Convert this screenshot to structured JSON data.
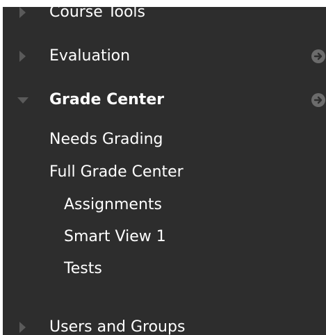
{
  "menu": {
    "course_tools": "Course Tools",
    "evaluation": "Evaluation",
    "grade_center": "Grade Center",
    "grade_center_items": [
      {
        "label": "Needs Grading"
      },
      {
        "label": "Full Grade Center"
      },
      {
        "label": "Assignments"
      },
      {
        "label": "Smart View 1"
      },
      {
        "label": "Tests"
      }
    ],
    "users_and_groups": "Users and Groups"
  },
  "colors": {
    "panel_bg": "#2d2d2d",
    "text": "#ffffff",
    "arrow": "#5a5a5a",
    "go_icon": "#6b6b6b"
  },
  "icons": {
    "collapsed": "triangle-right-icon",
    "expanded": "triangle-down-icon",
    "go": "circle-arrow-right-icon"
  }
}
